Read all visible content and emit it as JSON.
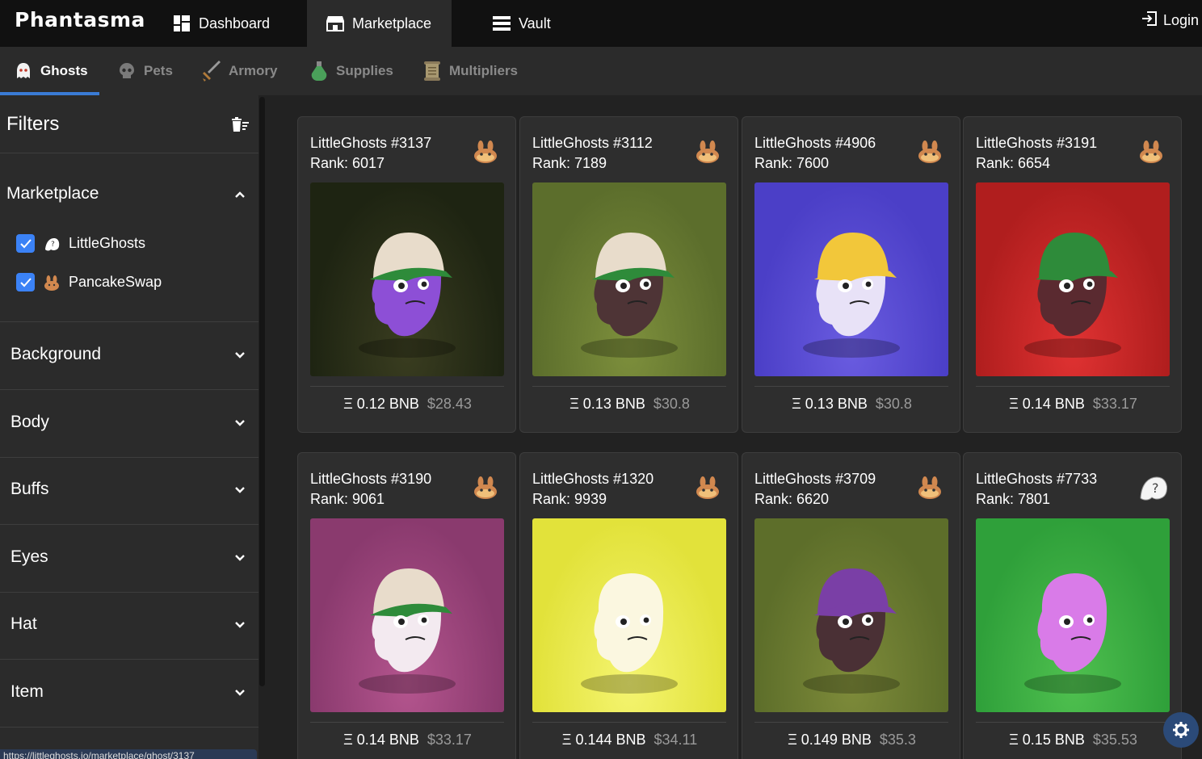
{
  "app": {
    "logo_text": "Phantasma"
  },
  "topnav": {
    "items": [
      {
        "label": "Dashboard",
        "icon": "dashboard-icon"
      },
      {
        "label": "Marketplace",
        "icon": "store-icon",
        "active": true
      },
      {
        "label": "Vault",
        "icon": "vault-icon"
      }
    ],
    "login_label": "Login"
  },
  "subtabs": [
    {
      "label": "Ghosts",
      "icon": "ghost-icon",
      "active": true
    },
    {
      "label": "Pets",
      "icon": "skull-icon"
    },
    {
      "label": "Armory",
      "icon": "sword-icon"
    },
    {
      "label": "Supplies",
      "icon": "potion-icon"
    },
    {
      "label": "Multipliers",
      "icon": "scroll-icon"
    }
  ],
  "sidebar": {
    "filters_title": "Filters",
    "marketplace": {
      "title": "Marketplace",
      "options": [
        {
          "label": "LittleGhosts",
          "checked": true,
          "icon": "littleghosts-icon"
        },
        {
          "label": "PancakeSwap",
          "checked": true,
          "icon": "pancakeswap-icon"
        }
      ]
    },
    "sections": [
      "Background",
      "Body",
      "Buffs",
      "Eyes",
      "Hat",
      "Item"
    ]
  },
  "status_url": "https://littleghosts.io/marketplace/ghost/3137",
  "cards": [
    {
      "name": "LittleGhosts #3137",
      "rank": "Rank: 6017",
      "price": "Ξ 0.12 BNB",
      "usd": "$28.43",
      "badge": "pancakeswap",
      "bg": "#1e2412",
      "bg2": "#3a3d20",
      "body": "#8d4fd6",
      "hat": "#e8dccb",
      "brim": "#2e8b3a"
    },
    {
      "name": "LittleGhosts #3112",
      "rank": "Rank: 7189",
      "price": "Ξ 0.13 BNB",
      "usd": "$30.8",
      "badge": "pancakeswap",
      "bg": "#5c6e2c",
      "bg2": "#7d8f3c",
      "body": "#4e3436",
      "hat": "#e8dccb",
      "brim": "#2e8b3a"
    },
    {
      "name": "LittleGhosts #4906",
      "rank": "Rank: 7600",
      "price": "Ξ 0.13 BNB",
      "usd": "$30.8",
      "badge": "pancakeswap",
      "bg": "#4b3fc7",
      "bg2": "#6a5ce0",
      "body": "#e8e2f7",
      "hat": "#f2c73a",
      "brim": "#f2c73a"
    },
    {
      "name": "LittleGhosts #3191",
      "rank": "Rank: 6654",
      "price": "Ξ 0.14 BNB",
      "usd": "$33.17",
      "badge": "pancakeswap",
      "bg": "#b01e1e",
      "bg2": "#e03232",
      "body": "#5a2a30",
      "hat": "#2e8b3a",
      "brim": "#2e8b3a"
    },
    {
      "name": "LittleGhosts #3190",
      "rank": "Rank: 9061",
      "price": "Ξ 0.14 BNB",
      "usd": "$33.17",
      "badge": "pancakeswap",
      "bg": "#8a3a6e",
      "bg2": "#b4558e",
      "body": "#f3eaf0",
      "hat": "#e8dccb",
      "brim": "#2e8b3a"
    },
    {
      "name": "LittleGhosts #1320",
      "rank": "Rank: 9939",
      "price": "Ξ 0.144 BNB",
      "usd": "$34.11",
      "badge": "pancakeswap",
      "bg": "#e2e23a",
      "bg2": "#f4f470",
      "body": "#fbf7e0",
      "hat": "",
      "brim": ""
    },
    {
      "name": "LittleGhosts #3709",
      "rank": "Rank: 6620",
      "price": "Ξ 0.149 BNB",
      "usd": "$35.3",
      "badge": "pancakeswap",
      "bg": "#5d6e2a",
      "bg2": "#7e8b3a",
      "body": "#4a3035",
      "hat": "#7a3fa6",
      "brim": "#7a3fa6"
    },
    {
      "name": "LittleGhosts #7733",
      "rank": "Rank: 7801",
      "price": "Ξ 0.15 BNB",
      "usd": "$35.53",
      "badge": "littleghosts",
      "bg": "#2fa03a",
      "bg2": "#4fc04f",
      "body": "#d97be8",
      "hat": "",
      "brim": ""
    }
  ]
}
